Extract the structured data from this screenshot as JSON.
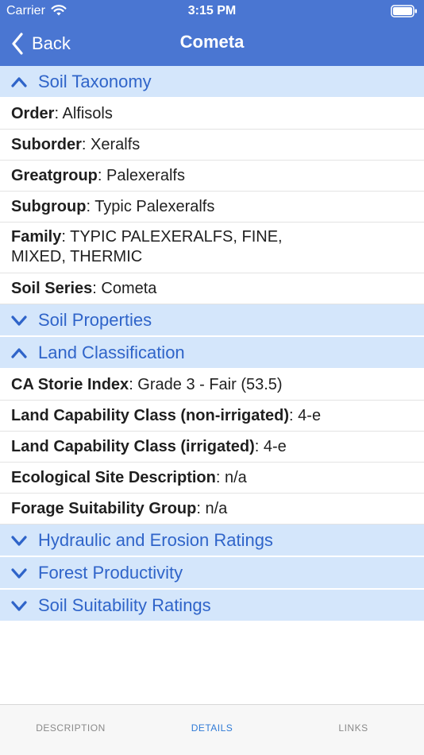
{
  "status": {
    "carrier": "Carrier",
    "time": "3:15 PM"
  },
  "nav": {
    "back_label": "Back",
    "title": "Cometa"
  },
  "sections": {
    "soil_taxonomy": {
      "label": "Soil Taxonomy",
      "expanded": true,
      "rows": [
        {
          "key": "Order",
          "value": ": Alfisols"
        },
        {
          "key": "Suborder",
          "value": ": Xeralfs"
        },
        {
          "key": "Greatgroup",
          "value": ": Palexeralfs"
        },
        {
          "key": "Subgroup",
          "value": ": Typic Palexeralfs"
        },
        {
          "key": "Family",
          "value": ": TYPIC PALEXERALFS, FINE,",
          "value2": "MIXED, THERMIC"
        },
        {
          "key": "Soil Series",
          "value": ": Cometa"
        }
      ]
    },
    "soil_properties": {
      "label": "Soil Properties",
      "expanded": false
    },
    "land_classification": {
      "label": "Land Classification",
      "expanded": true,
      "rows": [
        {
          "key": "CA Storie Index",
          "value": ": Grade 3 - Fair (53.5)"
        },
        {
          "key": "Land Capability Class (non-irrigated)",
          "value": ": 4-e"
        },
        {
          "key": "Land Capability Class (irrigated)",
          "value": ": 4-e"
        },
        {
          "key": "Ecological Site Description",
          "value": ": n/a"
        },
        {
          "key": "Forage Suitability Group",
          "value": ": n/a"
        }
      ]
    },
    "hydraulic_erosion": {
      "label": "Hydraulic and Erosion Ratings",
      "expanded": false
    },
    "forest_productivity": {
      "label": "Forest Productivity",
      "expanded": false
    },
    "soil_suitability": {
      "label": "Soil Suitability Ratings",
      "expanded": false
    }
  },
  "tabs": {
    "description": "DESCRIPTION",
    "details": "DETAILS",
    "links": "LINKS",
    "active": "details"
  },
  "colors": {
    "nav_bar": "#4a76d2",
    "section_header_bg": "#d4e6fb",
    "section_header_text": "#2f64c9",
    "tab_active": "#2f7ad6"
  },
  "icons": {
    "collapse": "chevron-up-icon",
    "expand": "chevron-down-icon",
    "back": "chevron-left-icon",
    "wifi": "wifi-icon",
    "battery": "battery-icon"
  }
}
